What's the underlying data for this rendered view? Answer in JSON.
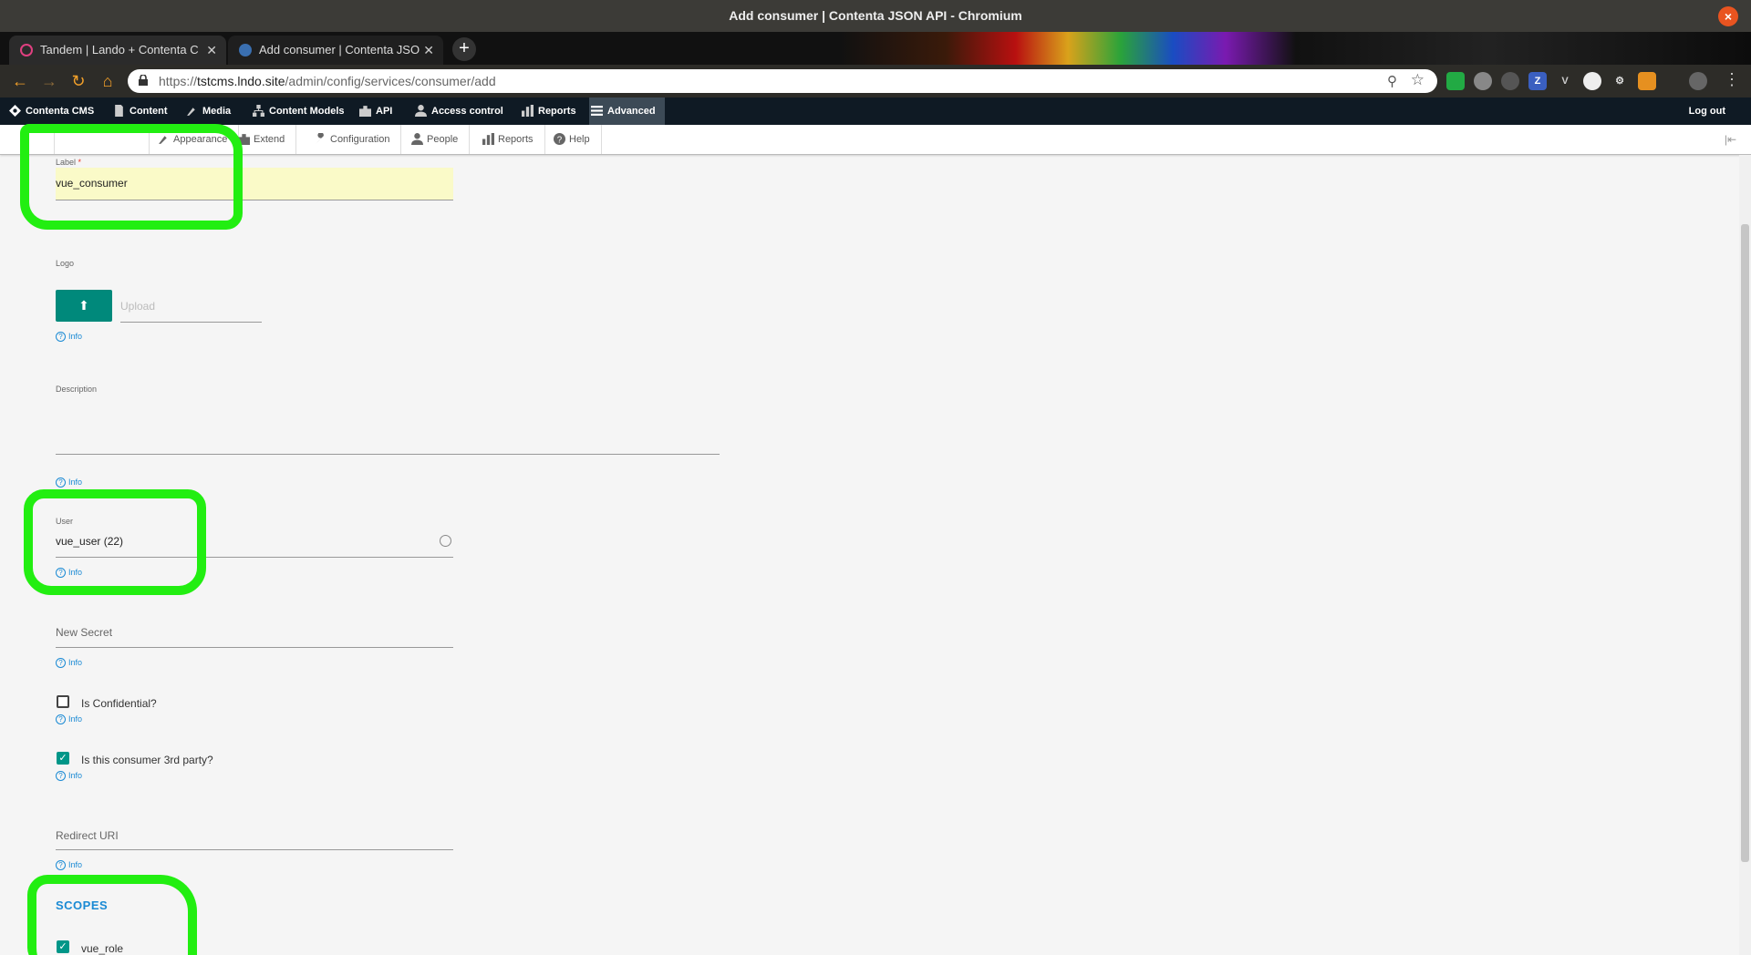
{
  "window": {
    "title": "Add consumer | Contenta JSON API - Chromium"
  },
  "tabs": [
    {
      "label": "Tandem | Lando + Contenta C"
    },
    {
      "label": "Add consumer | Contenta JSO"
    }
  ],
  "address": {
    "scheme": "https://",
    "host": "tstcms.lndo.site",
    "path": "/admin/config/services/consumer/add"
  },
  "admin_toolbar": {
    "items": [
      "Contenta CMS",
      "Content",
      "Media",
      "Content Models",
      "API",
      "Access control",
      "Reports",
      "Advanced"
    ],
    "logout": "Log out"
  },
  "tray": {
    "items": [
      "Appearance",
      "Extend",
      "Configuration",
      "People",
      "Reports",
      "Help"
    ]
  },
  "form": {
    "label_field": {
      "label": "Label",
      "required": "*",
      "value": "vue_consumer"
    },
    "logo": {
      "label": "Logo",
      "upload_placeholder": "Upload",
      "info": "Info"
    },
    "description": {
      "label": "Description",
      "info": "Info"
    },
    "user": {
      "label": "User",
      "value": "vue_user (22)",
      "info": "Info"
    },
    "new_secret": {
      "placeholder": "New Secret",
      "info": "Info"
    },
    "is_confidential": {
      "label": "Is Confidential?",
      "checked": false,
      "info": "Info"
    },
    "third_party": {
      "label": "Is this consumer 3rd party?",
      "checked": true,
      "info": "Info"
    },
    "redirect_uri": {
      "placeholder": "Redirect URI",
      "info": "Info"
    },
    "scopes": {
      "heading": "SCOPES",
      "items": [
        {
          "label": "vue_role",
          "checked": true
        }
      ]
    }
  },
  "colors": {
    "accent": "#009688",
    "link": "#1a8ad4",
    "highlight": "#22ee11",
    "admin_bar": "#0f1a24"
  }
}
